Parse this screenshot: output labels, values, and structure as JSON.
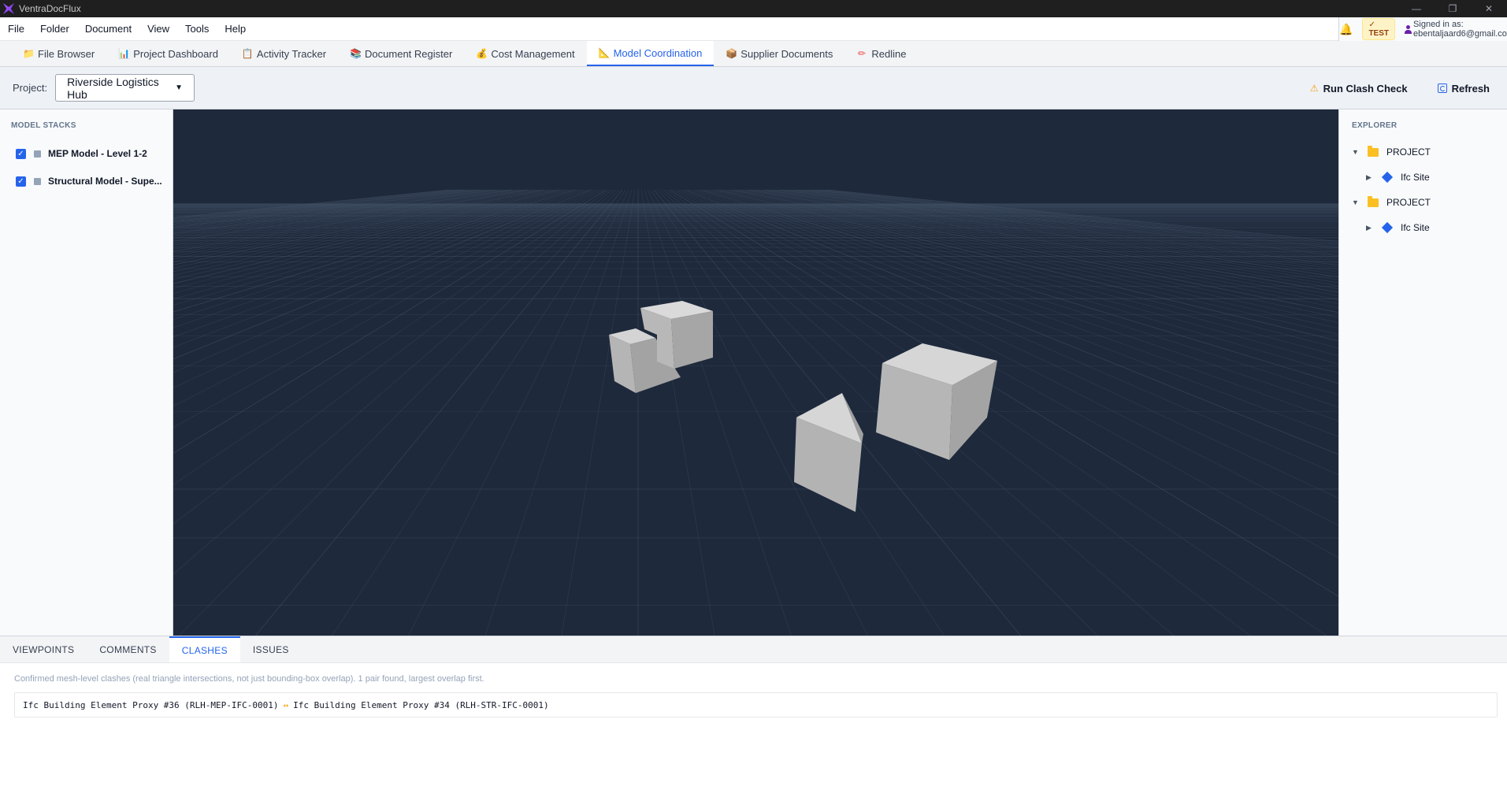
{
  "window": {
    "title": "VentraDocFlux",
    "controls": [
      "—",
      "❐",
      "✕"
    ]
  },
  "menu": [
    "File",
    "Folder",
    "Document",
    "View",
    "Tools",
    "Help"
  ],
  "header": {
    "badge": "TEST",
    "signed_in": "Signed in as: ebentaljaard6@gmail.com"
  },
  "tabs": [
    {
      "label": "File Browser",
      "icon": "folder-icon",
      "glyph": "📁"
    },
    {
      "label": "Project Dashboard",
      "icon": "chart-icon",
      "glyph": "📊"
    },
    {
      "label": "Activity Tracker",
      "icon": "clipboard-icon",
      "glyph": "📋"
    },
    {
      "label": "Document Register",
      "icon": "books-icon",
      "glyph": "📚"
    },
    {
      "label": "Cost Management",
      "icon": "money-bag-icon",
      "glyph": "💰"
    },
    {
      "label": "Model Coordination",
      "icon": "model-icon",
      "glyph": "📐"
    },
    {
      "label": "Supplier Documents",
      "icon": "package-icon",
      "glyph": "📦"
    },
    {
      "label": "Redline",
      "icon": "pencil-icon",
      "glyph": "✏"
    }
  ],
  "active_tab": "Model Coordination",
  "toolbar": {
    "project_label": "Project:",
    "project_value": "Riverside Logistics Hub",
    "run_clash": "Run Clash Check",
    "refresh": "Refresh"
  },
  "model_stacks": {
    "title": "MODEL STACKS",
    "items": [
      {
        "label": "MEP Model - Level 1-2",
        "checked": true
      },
      {
        "label": "Structural Model - Supe...",
        "checked": true
      }
    ]
  },
  "explorer": {
    "title": "EXPLORER",
    "nodes": [
      {
        "project": "PROJECT",
        "child": "Ifc Site"
      },
      {
        "project": "PROJECT",
        "child": "Ifc Site"
      }
    ]
  },
  "bottom_tabs": [
    "VIEWPOINTS",
    "COMMENTS",
    "CLASHES",
    "ISSUES"
  ],
  "active_bottom_tab": "CLASHES",
  "clashes": {
    "note": "Confirmed mesh-level clashes (real triangle intersections, not just bounding-box overlap). 1 pair found, largest overlap first.",
    "rows": [
      {
        "a": "Ifc Building Element Proxy #36 (RLH-MEP-IFC-0001)",
        "arrow": "↔",
        "b": "Ifc Building Element Proxy #34 (RLH-STR-IFC-0001)"
      }
    ]
  },
  "colors": {
    "accent": "#2563eb",
    "viewport_bg": "#1e293b",
    "grid": "#475569",
    "warning": "#f59e0b"
  }
}
